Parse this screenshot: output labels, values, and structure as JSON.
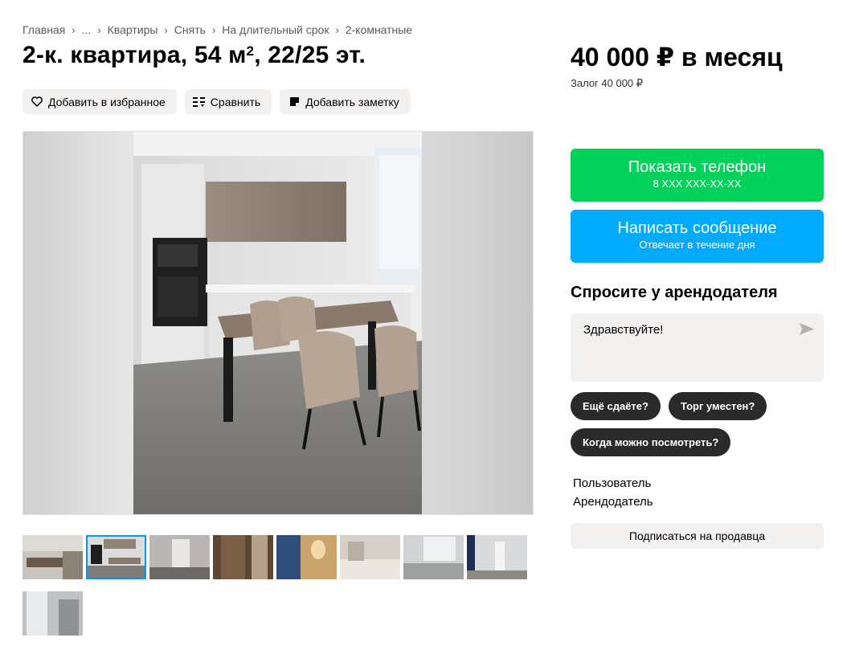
{
  "breadcrumbs": [
    "Главная",
    "...",
    "Квартиры",
    "Снять",
    "На длительный срок",
    "2-комнатные"
  ],
  "listing": {
    "title_main": "2-к. квартира, 54 м",
    "title_sup": "2",
    "title_tail": ", 22/25 эт."
  },
  "actions": {
    "favorite": "Добавить в избранное",
    "compare": "Сравнить",
    "note": "Добавить заметку"
  },
  "price": {
    "value": "40 000 ₽ в месяц",
    "deposit": "Залог 40 000 ₽"
  },
  "contact": {
    "phone_label": "Показать телефон",
    "phone_masked": "8 XXX XXX-XX-XX",
    "message_label": "Написать сообщение",
    "message_sub": "Отвечает в течение дня"
  },
  "ask": {
    "title": "Спросите у арендодателя",
    "message_value": "Здравствуйте!",
    "chips": [
      "Ещё сдаёте?",
      "Торг уместен?",
      "Когда можно посмотреть?"
    ]
  },
  "seller": {
    "type": "Пользователь",
    "role": "Арендодатель",
    "subscribe": "Подписаться на продавца"
  },
  "gallery": {
    "thumb_count": 9,
    "active_thumb": 2
  },
  "colors": {
    "green": "#02d15c",
    "blue": "#00aaff",
    "chip_dark": "#2a2a2a",
    "light_gray": "#f2f1f0",
    "active_outline": "#0099f7"
  }
}
